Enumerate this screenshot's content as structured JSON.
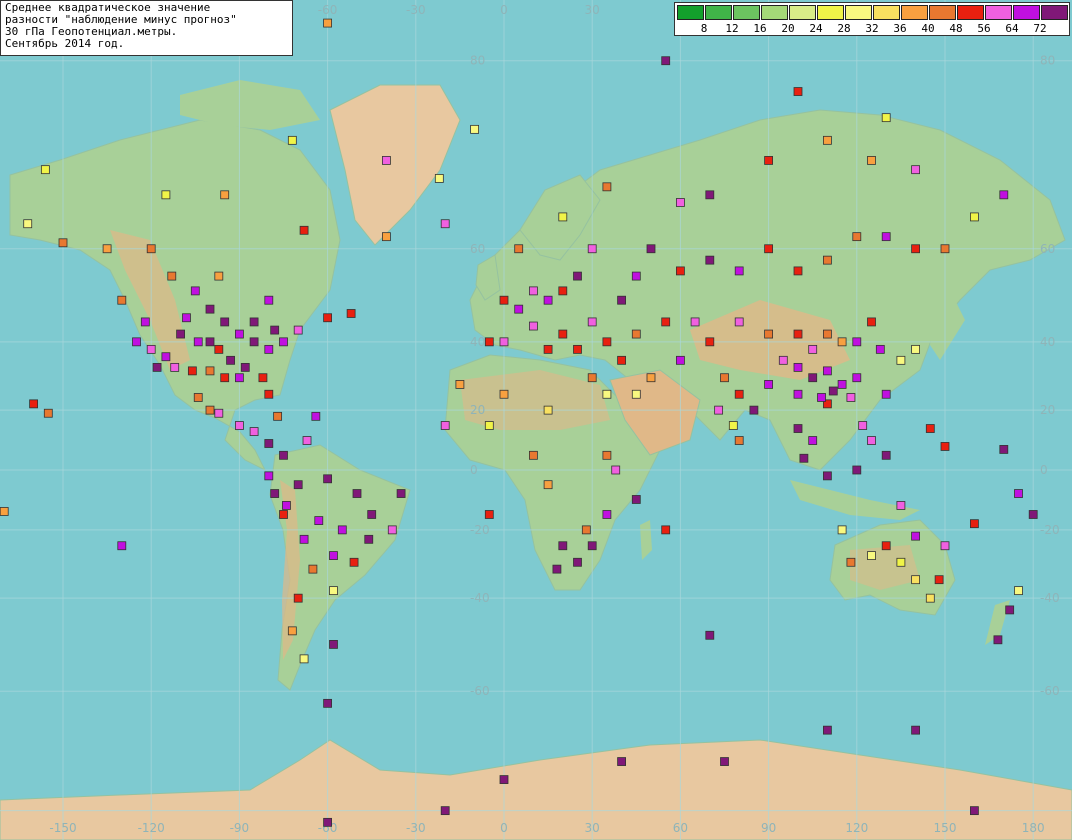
{
  "title": {
    "lines": [
      "Среднее квадратическое значение",
      "разности \"наблюдение минус прогноз\"",
      "30 гПа Геопотенциал.метры.",
      "Сентябрь 2014 год."
    ]
  },
  "legend": {
    "items": [
      {
        "label": "",
        "color": "#13a02c"
      },
      {
        "label": "8",
        "color": "#40b448"
      },
      {
        "label": "12",
        "color": "#6cc460"
      },
      {
        "label": "16",
        "color": "#a4d878"
      },
      {
        "label": "20",
        "color": "#d8ec88"
      },
      {
        "label": "24",
        "color": "#f0f448"
      },
      {
        "label": "28",
        "color": "#f8f880"
      },
      {
        "label": "32",
        "color": "#f8e060"
      },
      {
        "label": "36",
        "color": "#f8a040"
      },
      {
        "label": "40",
        "color": "#e87830"
      },
      {
        "label": "48",
        "color": "#e82010"
      },
      {
        "label": "56",
        "color": "#f060e0"
      },
      {
        "label": "64",
        "color": "#c010e0"
      },
      {
        "label": "72",
        "color": "#801878"
      }
    ]
  },
  "axes": {
    "lon_ticks": [
      "-150",
      "-120",
      "-90",
      "-60",
      "-30",
      "0",
      "30",
      "60",
      "90",
      "120",
      "150",
      "180"
    ],
    "lat_ticks": [
      "80",
      "60",
      "40",
      "20",
      "0",
      "-20",
      "-40",
      "-60"
    ]
  },
  "colors": {
    "ocean": "#7ecad0",
    "land": "#a8d098",
    "land_high": "#e0b888",
    "ice": "#f0e0c8",
    "grid": "#aad8dc"
  },
  "stations": [
    {
      "lon": -100,
      "lat": 48,
      "c": 13
    },
    {
      "lon": -95,
      "lat": 45,
      "c": 13
    },
    {
      "lon": -90,
      "lat": 42,
      "c": 12
    },
    {
      "lon": -85,
      "lat": 40,
      "c": 13
    },
    {
      "lon": -80,
      "lat": 38,
      "c": 12
    },
    {
      "lon": -97,
      "lat": 38,
      "c": 10
    },
    {
      "lon": -104,
      "lat": 40,
      "c": 12
    },
    {
      "lon": -110,
      "lat": 42,
      "c": 13
    },
    {
      "lon": -115,
      "lat": 36,
      "c": 12
    },
    {
      "lon": -120,
      "lat": 38,
      "c": 11
    },
    {
      "lon": -122,
      "lat": 45,
      "c": 12
    },
    {
      "lon": -88,
      "lat": 33,
      "c": 13
    },
    {
      "lon": -82,
      "lat": 30,
      "c": 10
    },
    {
      "lon": -95,
      "lat": 30,
      "c": 10
    },
    {
      "lon": -100,
      "lat": 32,
      "c": 9
    },
    {
      "lon": -106,
      "lat": 32,
      "c": 10
    },
    {
      "lon": -112,
      "lat": 33,
      "c": 11
    },
    {
      "lon": -75,
      "lat": 40,
      "c": 12
    },
    {
      "lon": -70,
      "lat": 43,
      "c": 11
    },
    {
      "lon": -60,
      "lat": 46,
      "c": 10
    },
    {
      "lon": -105,
      "lat": 52,
      "c": 12
    },
    {
      "lon": -97,
      "lat": 55,
      "c": 8
    },
    {
      "lon": -113,
      "lat": 55,
      "c": 9
    },
    {
      "lon": -80,
      "lat": 50,
      "c": 12
    },
    {
      "lon": -120,
      "lat": 60,
      "c": 9
    },
    {
      "lon": -135,
      "lat": 60,
      "c": 8
    },
    {
      "lon": -150,
      "lat": 61,
      "c": 9
    },
    {
      "lon": -162,
      "lat": 64,
      "c": 6
    },
    {
      "lon": -156,
      "lat": 71,
      "c": 5
    },
    {
      "lon": -115,
      "lat": 68,
      "c": 5
    },
    {
      "lon": -95,
      "lat": 68,
      "c": 8
    },
    {
      "lon": -68,
      "lat": 63,
      "c": 10
    },
    {
      "lon": -72,
      "lat": 74,
      "c": 5
    },
    {
      "lon": -40,
      "lat": 72,
      "c": 11
    },
    {
      "lon": -22,
      "lat": 70,
      "c": 6
    },
    {
      "lon": -40,
      "lat": 62,
      "c": 8
    },
    {
      "lon": -20,
      "lat": 64,
      "c": 11
    },
    {
      "lon": -10,
      "lat": 75,
      "c": 6
    },
    {
      "lon": -52,
      "lat": 47,
      "c": 10
    },
    {
      "lon": -100,
      "lat": 20,
      "c": 9
    },
    {
      "lon": -90,
      "lat": 15,
      "c": 11
    },
    {
      "lon": -80,
      "lat": 9,
      "c": 13
    },
    {
      "lon": -75,
      "lat": 5,
      "c": 13
    },
    {
      "lon": -70,
      "lat": -5,
      "c": 13
    },
    {
      "lon": -60,
      "lat": -3,
      "c": 13
    },
    {
      "lon": -50,
      "lat": -8,
      "c": 13
    },
    {
      "lon": -45,
      "lat": -15,
      "c": 13
    },
    {
      "lon": -55,
      "lat": -20,
      "c": 12
    },
    {
      "lon": -58,
      "lat": -28,
      "c": 12
    },
    {
      "lon": -65,
      "lat": -32,
      "c": 9
    },
    {
      "lon": -70,
      "lat": -40,
      "c": 10
    },
    {
      "lon": -72,
      "lat": -48,
      "c": 8
    },
    {
      "lon": -68,
      "lat": -54,
      "c": 6
    },
    {
      "lon": -58,
      "lat": -38,
      "c": 6
    },
    {
      "lon": -75,
      "lat": -15,
      "c": 10
    },
    {
      "lon": -80,
      "lat": -2,
      "c": 12
    },
    {
      "lon": -35,
      "lat": -8,
      "c": 13
    },
    {
      "lon": -38,
      "lat": -20,
      "c": 11
    },
    {
      "lon": -60,
      "lat": -62,
      "c": 13
    },
    {
      "lon": -58,
      "lat": -51,
      "c": 13
    },
    {
      "lon": -20,
      "lat": 15,
      "c": 11
    },
    {
      "lon": -15,
      "lat": 28,
      "c": 8
    },
    {
      "lon": 0,
      "lat": 50,
      "c": 10
    },
    {
      "lon": 5,
      "lat": 48,
      "c": 12
    },
    {
      "lon": 10,
      "lat": 52,
      "c": 11
    },
    {
      "lon": 15,
      "lat": 50,
      "c": 12
    },
    {
      "lon": 20,
      "lat": 52,
      "c": 10
    },
    {
      "lon": 25,
      "lat": 55,
      "c": 13
    },
    {
      "lon": 30,
      "lat": 60,
      "c": 11
    },
    {
      "lon": 5,
      "lat": 60,
      "c": 9
    },
    {
      "lon": 20,
      "lat": 65,
      "c": 5
    },
    {
      "lon": -5,
      "lat": 40,
      "c": 10
    },
    {
      "lon": 10,
      "lat": 44,
      "c": 11
    },
    {
      "lon": 20,
      "lat": 42,
      "c": 10
    },
    {
      "lon": 30,
      "lat": 45,
      "c": 11
    },
    {
      "lon": 40,
      "lat": 50,
      "c": 13
    },
    {
      "lon": 45,
      "lat": 55,
      "c": 12
    },
    {
      "lon": 50,
      "lat": 60,
      "c": 13
    },
    {
      "lon": 60,
      "lat": 56,
      "c": 10
    },
    {
      "lon": 70,
      "lat": 58,
      "c": 13
    },
    {
      "lon": 80,
      "lat": 56,
      "c": 12
    },
    {
      "lon": 90,
      "lat": 60,
      "c": 10
    },
    {
      "lon": 100,
      "lat": 56,
      "c": 10
    },
    {
      "lon": 110,
      "lat": 58,
      "c": 9
    },
    {
      "lon": 120,
      "lat": 62,
      "c": 9
    },
    {
      "lon": 130,
      "lat": 62,
      "c": 12
    },
    {
      "lon": 140,
      "lat": 60,
      "c": 10
    },
    {
      "lon": 150,
      "lat": 60,
      "c": 9
    },
    {
      "lon": 160,
      "lat": 65,
      "c": 5
    },
    {
      "lon": 170,
      "lat": 68,
      "c": 12
    },
    {
      "lon": 70,
      "lat": 68,
      "c": 13
    },
    {
      "lon": 90,
      "lat": 72,
      "c": 10
    },
    {
      "lon": 110,
      "lat": 74,
      "c": 8
    },
    {
      "lon": 125,
      "lat": 72,
      "c": 8
    },
    {
      "lon": 140,
      "lat": 71,
      "c": 11
    },
    {
      "lon": 55,
      "lat": 80,
      "c": 13
    },
    {
      "lon": 35,
      "lat": 69,
      "c": 9
    },
    {
      "lon": 60,
      "lat": 67,
      "c": 11
    },
    {
      "lon": -60,
      "lat": 82,
      "c": 8
    },
    {
      "lon": 100,
      "lat": 78,
      "c": 10
    },
    {
      "lon": 130,
      "lat": 76,
      "c": 5
    },
    {
      "lon": 30,
      "lat": 30,
      "c": 9
    },
    {
      "lon": 35,
      "lat": 25,
      "c": 6
    },
    {
      "lon": 45,
      "lat": 25,
      "c": 6
    },
    {
      "lon": 40,
      "lat": 35,
      "c": 10
    },
    {
      "lon": 50,
      "lat": 30,
      "c": 8
    },
    {
      "lon": 60,
      "lat": 35,
      "c": 12
    },
    {
      "lon": 70,
      "lat": 40,
      "c": 10
    },
    {
      "lon": 75,
      "lat": 30,
      "c": 9
    },
    {
      "lon": 80,
      "lat": 25,
      "c": 10
    },
    {
      "lon": 85,
      "lat": 20,
      "c": 13
    },
    {
      "lon": 78,
      "lat": 15,
      "c": 5
    },
    {
      "lon": 73,
      "lat": 20,
      "c": 11
    },
    {
      "lon": 80,
      "lat": 10,
      "c": 9
    },
    {
      "lon": 90,
      "lat": 28,
      "c": 12
    },
    {
      "lon": 95,
      "lat": 35,
      "c": 11
    },
    {
      "lon": 100,
      "lat": 25,
      "c": 12
    },
    {
      "lon": 105,
      "lat": 30,
      "c": 13
    },
    {
      "lon": 110,
      "lat": 32,
      "c": 12
    },
    {
      "lon": 115,
      "lat": 28,
      "c": 12
    },
    {
      "lon": 120,
      "lat": 30,
      "c": 12
    },
    {
      "lon": 110,
      "lat": 22,
      "c": 10
    },
    {
      "lon": 115,
      "lat": 40,
      "c": 8
    },
    {
      "lon": 120,
      "lat": 40,
      "c": 12
    },
    {
      "lon": 125,
      "lat": 45,
      "c": 10
    },
    {
      "lon": 128,
      "lat": 38,
      "c": 12
    },
    {
      "lon": 135,
      "lat": 35,
      "c": 6
    },
    {
      "lon": 140,
      "lat": 38,
      "c": 6
    },
    {
      "lon": 130,
      "lat": 25,
      "c": 12
    },
    {
      "lon": 100,
      "lat": 14,
      "c": 13
    },
    {
      "lon": 105,
      "lat": 10,
      "c": 12
    },
    {
      "lon": 102,
      "lat": 4,
      "c": 13
    },
    {
      "lon": 110,
      "lat": -2,
      "c": 13
    },
    {
      "lon": 120,
      "lat": 0,
      "c": 13
    },
    {
      "lon": 125,
      "lat": 10,
      "c": 11
    },
    {
      "lon": 130,
      "lat": 5,
      "c": 13
    },
    {
      "lon": 145,
      "lat": 14,
      "c": 10
    },
    {
      "lon": 150,
      "lat": 8,
      "c": 10
    },
    {
      "lon": 170,
      "lat": 7,
      "c": 13
    },
    {
      "lon": 175,
      "lat": -8,
      "c": 12
    },
    {
      "lon": 180,
      "lat": -15,
      "c": 13
    },
    {
      "lon": 135,
      "lat": -12,
      "c": 11
    },
    {
      "lon": 115,
      "lat": -20,
      "c": 6
    },
    {
      "lon": 118,
      "lat": -30,
      "c": 9
    },
    {
      "lon": 130,
      "lat": -25,
      "c": 10
    },
    {
      "lon": 140,
      "lat": -22,
      "c": 12
    },
    {
      "lon": 150,
      "lat": -25,
      "c": 11
    },
    {
      "lon": 148,
      "lat": -35,
      "c": 10
    },
    {
      "lon": 140,
      "lat": -35,
      "c": 7
    },
    {
      "lon": 135,
      "lat": -30,
      "c": 5
    },
    {
      "lon": 125,
      "lat": -28,
      "c": 6
    },
    {
      "lon": 145,
      "lat": -40,
      "c": 7
    },
    {
      "lon": 172,
      "lat": -43,
      "c": 13
    },
    {
      "lon": 175,
      "lat": -38,
      "c": 6
    },
    {
      "lon": 168,
      "lat": -50,
      "c": 13
    },
    {
      "lon": 160,
      "lat": -18,
      "c": 10
    },
    {
      "lon": 20,
      "lat": -25,
      "c": 13
    },
    {
      "lon": 25,
      "lat": -30,
      "c": 13
    },
    {
      "lon": 30,
      "lat": -25,
      "c": 13
    },
    {
      "lon": 18,
      "lat": -32,
      "c": 13
    },
    {
      "lon": 35,
      "lat": -15,
      "c": 12
    },
    {
      "lon": 28,
      "lat": -20,
      "c": 9
    },
    {
      "lon": 10,
      "lat": 5,
      "c": 9
    },
    {
      "lon": 35,
      "lat": 5,
      "c": 9
    },
    {
      "lon": 45,
      "lat": -10,
      "c": 13
    },
    {
      "lon": 55,
      "lat": -20,
      "c": 10
    },
    {
      "lon": 38,
      "lat": 0,
      "c": 11
    },
    {
      "lon": 15,
      "lat": -5,
      "c": 8
    },
    {
      "lon": -5,
      "lat": 15,
      "c": 5
    },
    {
      "lon": 0,
      "lat": 25,
      "c": 8
    },
    {
      "lon": 15,
      "lat": 20,
      "c": 7
    },
    {
      "lon": 70,
      "lat": -49,
      "c": 13
    },
    {
      "lon": -5,
      "lat": -15,
      "c": 10
    },
    {
      "lon": -170,
      "lat": -14,
      "c": 8
    },
    {
      "lon": -175,
      "lat": -22,
      "c": 10
    },
    {
      "lon": -160,
      "lat": 22,
      "c": 10
    },
    {
      "lon": -155,
      "lat": 19,
      "c": 9
    },
    {
      "lon": -130,
      "lat": -25,
      "c": 12
    },
    {
      "lon": -60,
      "lat": -76,
      "c": 13
    },
    {
      "lon": -20,
      "lat": -75,
      "c": 13
    },
    {
      "lon": 0,
      "lat": -72,
      "c": 13
    },
    {
      "lon": 40,
      "lat": -70,
      "c": 13
    },
    {
      "lon": 75,
      "lat": -70,
      "c": 13
    },
    {
      "lon": 110,
      "lat": -66,
      "c": 13
    },
    {
      "lon": 140,
      "lat": -66,
      "c": 13
    },
    {
      "lon": 160,
      "lat": -75,
      "c": 13
    },
    {
      "lon": -130,
      "lat": 50,
      "c": 9
    },
    {
      "lon": -125,
      "lat": 40,
      "c": 12
    },
    {
      "lon": -118,
      "lat": 33,
      "c": 13
    },
    {
      "lon": -90,
      "lat": 30,
      "c": 12
    },
    {
      "lon": -85,
      "lat": 45,
      "c": 13
    },
    {
      "lon": -78,
      "lat": 43,
      "c": 13
    },
    {
      "lon": -93,
      "lat": 35,
      "c": 13
    },
    {
      "lon": -100,
      "lat": 40,
      "c": 13
    },
    {
      "lon": -108,
      "lat": 46,
      "c": 12
    },
    {
      "lon": 0,
      "lat": 40,
      "c": 11
    },
    {
      "lon": 15,
      "lat": 38,
      "c": 10
    },
    {
      "lon": 25,
      "lat": 38,
      "c": 10
    },
    {
      "lon": 35,
      "lat": 40,
      "c": 10
    },
    {
      "lon": 45,
      "lat": 42,
      "c": 9
    },
    {
      "lon": 55,
      "lat": 45,
      "c": 10
    },
    {
      "lon": 65,
      "lat": 45,
      "c": 11
    },
    {
      "lon": 80,
      "lat": 45,
      "c": 11
    },
    {
      "lon": 90,
      "lat": 42,
      "c": 9
    },
    {
      "lon": 100,
      "lat": 42,
      "c": 10
    },
    {
      "lon": 110,
      "lat": 42,
      "c": 9
    },
    {
      "lon": 105,
      "lat": 38,
      "c": 11
    },
    {
      "lon": 100,
      "lat": 33,
      "c": 12
    },
    {
      "lon": 112,
      "lat": 26,
      "c": 13
    },
    {
      "lon": 108,
      "lat": 24,
      "c": 12
    },
    {
      "lon": 118,
      "lat": 24,
      "c": 11
    },
    {
      "lon": 122,
      "lat": 15,
      "c": 11
    },
    {
      "lon": -46,
      "lat": -23,
      "c": 13
    },
    {
      "lon": -51,
      "lat": -30,
      "c": 10
    },
    {
      "lon": -63,
      "lat": -17,
      "c": 12
    },
    {
      "lon": -68,
      "lat": -23,
      "c": 12
    },
    {
      "lon": -78,
      "lat": -8,
      "c": 13
    },
    {
      "lon": -74,
      "lat": -12,
      "c": 12
    },
    {
      "lon": -67,
      "lat": 10,
      "c": 11
    },
    {
      "lon": -85,
      "lat": 13,
      "c": 11
    },
    {
      "lon": -104,
      "lat": 24,
      "c": 9
    },
    {
      "lon": -97,
      "lat": 19,
      "c": 11
    },
    {
      "lon": -64,
      "lat": 18,
      "c": 12
    },
    {
      "lon": -77,
      "lat": 18,
      "c": 9
    },
    {
      "lon": -80,
      "lat": 25,
      "c": 10
    }
  ]
}
